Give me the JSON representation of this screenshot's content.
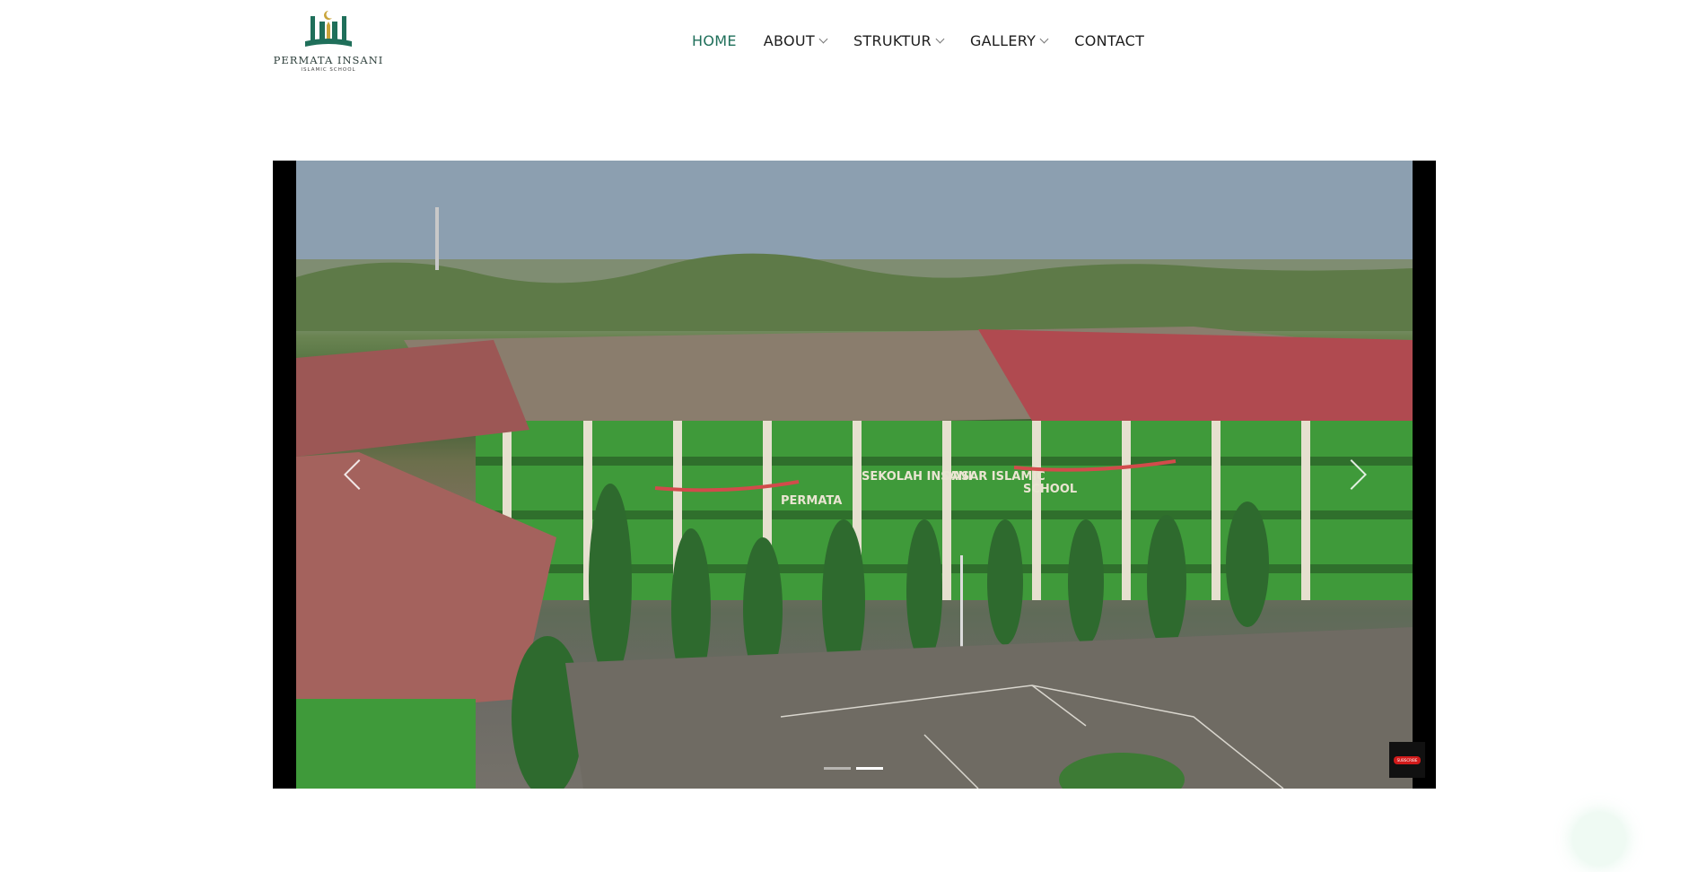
{
  "brand": {
    "name": "PERMATA INSANI",
    "tagline": "ISLAMIC SCHOOL",
    "colors": {
      "primary_green": "#1f6f5a",
      "gold": "#c9a43a"
    }
  },
  "nav": {
    "items": [
      {
        "label": "HOME",
        "active": true,
        "has_dropdown": false
      },
      {
        "label": "ABOUT",
        "active": false,
        "has_dropdown": true
      },
      {
        "label": "STRUKTUR",
        "active": false,
        "has_dropdown": true
      },
      {
        "label": "GALLERY",
        "active": false,
        "has_dropdown": true
      },
      {
        "label": "CONTACT",
        "active": false,
        "has_dropdown": false
      }
    ]
  },
  "slider": {
    "building_sign": [
      "PERMATA",
      "SEKOLAH INSANI",
      "DASAR ISLAMIC",
      "SCHOOL"
    ],
    "slide_count": 2,
    "active_slide": 2,
    "subscribe_label": "SUBSCRIBE",
    "icons": {
      "prev": "chevron-left-icon",
      "next": "chevron-right-icon"
    }
  }
}
